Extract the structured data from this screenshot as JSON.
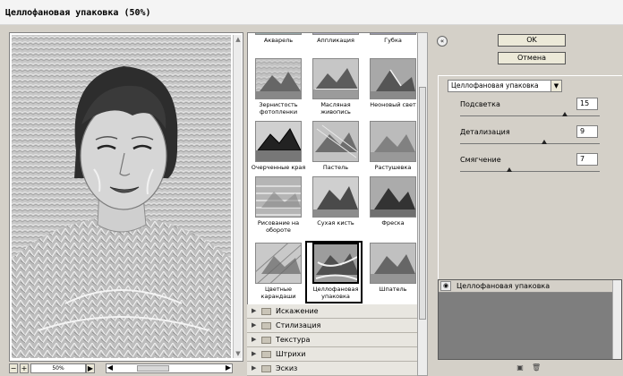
{
  "window": {
    "title": "Целлофановая упаковка (50%)"
  },
  "preview": {
    "zoom": "50%",
    "minus": "−",
    "plus": "+"
  },
  "gallery": {
    "rows": [
      [
        {
          "label": "Акварель"
        },
        {
          "label": "Аппликация"
        },
        {
          "label": "Губка"
        }
      ],
      [
        {
          "label": "Зернистость фотопленки"
        },
        {
          "label": "Масляная живопись"
        },
        {
          "label": "Неоновый свет"
        }
      ],
      [
        {
          "label": "Очерченные края"
        },
        {
          "label": "Пастель"
        },
        {
          "label": "Растушевка"
        }
      ],
      [
        {
          "label": "Рисование на обороте"
        },
        {
          "label": "Сухая кисть"
        },
        {
          "label": "Фреска"
        }
      ],
      [
        {
          "label": "Цветные карандаши"
        },
        {
          "label": "Целлофановая упаковка"
        },
        {
          "label": "Шпатель"
        }
      ]
    ],
    "selected": "Целлофановая упаковка"
  },
  "categories": [
    "Искажение",
    "Стилизация",
    "Текстура",
    "Штрихи",
    "Эскиз"
  ],
  "buttons": {
    "ok": "OK",
    "cancel": "Отмена"
  },
  "filter_select": {
    "value": "Целлофановая упаковка"
  },
  "params": [
    {
      "label": "Подсветка",
      "value": "15",
      "fraction": 0.75
    },
    {
      "label": "Детализация",
      "value": "9",
      "fraction": 0.6
    },
    {
      "label": "Смягчение",
      "value": "7",
      "fraction": 0.35
    }
  ],
  "layers": {
    "items": [
      {
        "name": "Целлофановая упаковка"
      }
    ]
  }
}
